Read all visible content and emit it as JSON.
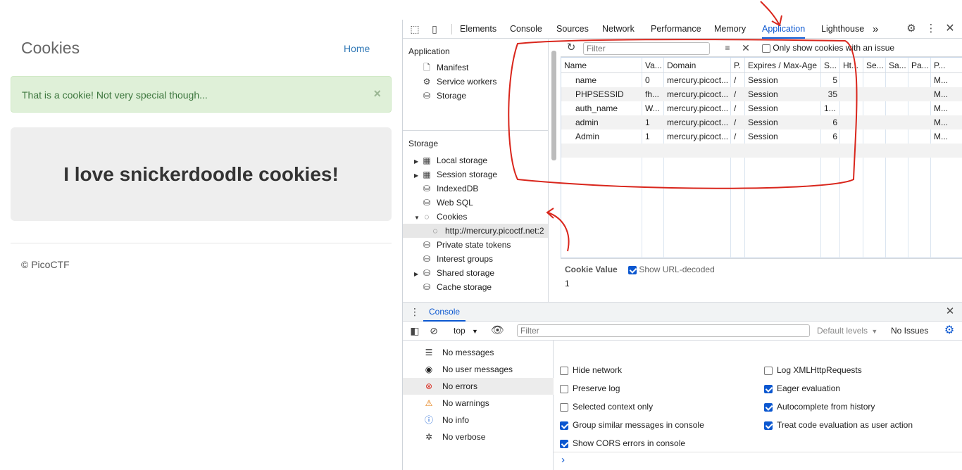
{
  "page": {
    "title": "Cookies",
    "home_link": "Home",
    "alert_text": "That is a cookie! Not very special though...",
    "alert_close": "×",
    "jumbotron": "I love snickerdoodle cookies!",
    "footer": "© PicoCTF"
  },
  "devtools": {
    "tabs": [
      "Elements",
      "Console",
      "Sources",
      "Network",
      "Performance",
      "Memory",
      "Application",
      "Lighthouse"
    ],
    "active_tab": "Application",
    "more_tabs": "»",
    "sidebar": {
      "application_header": "Application",
      "application_items": [
        "Manifest",
        "Service workers",
        "Storage"
      ],
      "storage_header": "Storage",
      "storage_items": [
        "Local storage",
        "Session storage",
        "IndexedDB",
        "Web SQL",
        "Cookies"
      ],
      "cookie_origin": "http://mercury.picoctf.net:2",
      "other_items": [
        "Private state tokens",
        "Interest groups",
        "Shared storage",
        "Cache storage"
      ]
    },
    "cookie_toolbar": {
      "filter_placeholder": "Filter",
      "only_issues_label": "Only show cookies with an issue"
    },
    "cookie_table": {
      "headers": [
        "Name",
        "Va...",
        "Domain",
        "P.",
        "Expires / Max-Age",
        "S...",
        "Ht...",
        "Se...",
        "Sa...",
        "Pa...",
        "P..."
      ],
      "rows": [
        [
          "name",
          "0",
          "mercury.picoct...",
          "/",
          "Session",
          "5",
          "M..."
        ],
        [
          "PHPSESSID",
          "fh...",
          "mercury.picoct...",
          "/",
          "Session",
          "35",
          "M..."
        ],
        [
          "auth_name",
          "W...",
          "mercury.picoct...",
          "/",
          "Session",
          "1...",
          "M..."
        ],
        [
          "admin",
          "1",
          "mercury.picoct...",
          "/",
          "Session",
          "6",
          "M..."
        ],
        [
          "Admin",
          "1",
          "mercury.picoct...",
          "/",
          "Session",
          "6",
          "M..."
        ]
      ]
    },
    "cookie_value": {
      "label": "Cookie Value",
      "decoded_label": "Show URL-decoded",
      "value": "1"
    },
    "drawer": {
      "tab": "Console",
      "context": "top",
      "filter_placeholder": "Filter",
      "levels": "Default levels",
      "issues": "No Issues",
      "messages": [
        "No messages",
        "No user messages",
        "No errors",
        "No warnings",
        "No info",
        "No verbose"
      ],
      "options_left": [
        "Hide network",
        "Preserve log",
        "Selected context only",
        "Group similar messages in console",
        "Show CORS errors in console"
      ],
      "options_right": [
        "Log XMLHttpRequests",
        "Eager evaluation",
        "Autocomplete from history",
        "Treat code evaluation as user action"
      ],
      "prompt": "›"
    }
  }
}
